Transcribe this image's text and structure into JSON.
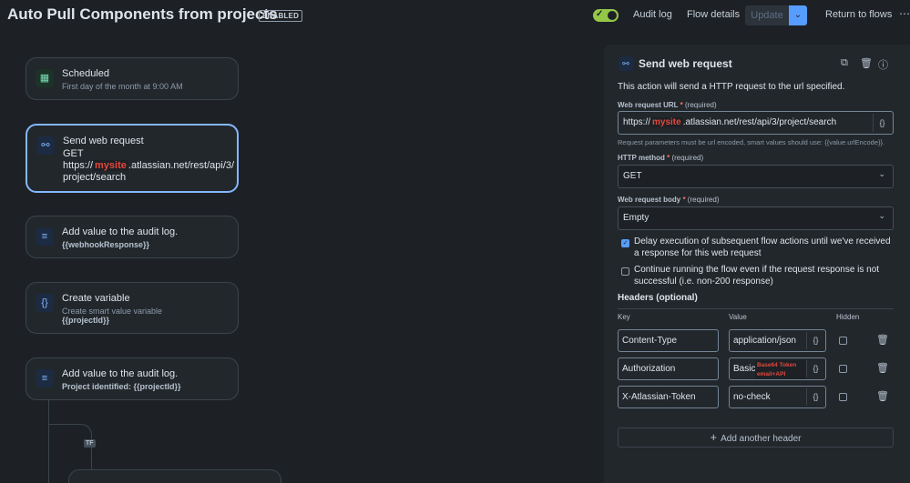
{
  "header": {
    "title": "Auto Pull Components from projects",
    "status_badge": "ENABLED",
    "audit_log": "Audit log",
    "flow_details": "Flow details",
    "update": "Update",
    "return": "Return to flows"
  },
  "nodes": [
    {
      "title": "Scheduled",
      "sub": "First day of the month at 9:00 AM",
      "icon": "calendar-icon"
    },
    {
      "title": "Send web request",
      "method": "GET",
      "url_prefix": "https://",
      "redacted": "mysite",
      "url_suffix": ".atlassian.net/rest/api/3/",
      "url_line2": "project/search",
      "icon": "webhook-icon"
    },
    {
      "title": "Add value to the audit log.",
      "sub": "{{webhookResponse}}",
      "icon": "log-icon"
    },
    {
      "title": "Create variable",
      "sub": "Create smart value variable",
      "sub2": "{{projectId}}",
      "icon": "variable-icon"
    },
    {
      "title": "Add value to the audit log.",
      "sub": "Project identified: {{projectId}}",
      "icon": "log-icon"
    }
  ],
  "branch_tag": "TF",
  "panel": {
    "title": "Send web request",
    "description": "This action will send a HTTP request to the url specified.",
    "url_label": "Web request URL",
    "required": "(required)",
    "url_prefix": "https://",
    "url_redacted": "mysite",
    "url_suffix": ".atlassian.net/rest/api/3/project/search",
    "url_hint": "Request parameters must be url encoded, smart values should use: {{value.urlEncode}}.",
    "method_label": "HTTP method",
    "method_value": "GET",
    "body_label": "Web request body",
    "body_value": "Empty",
    "delay_text": "Delay execution of subsequent flow actions until we've received a response for this web request",
    "delay_checked": true,
    "continue_text": "Continue running the flow even if the request response is not successful (i.e. non-200 response)",
    "continue_checked": false,
    "headers_title": "Headers (optional)",
    "col_key": "Key",
    "col_value": "Value",
    "col_hidden": "Hidden",
    "headers": [
      {
        "key": "Content-Type",
        "value": "application/json"
      },
      {
        "key": "Authorization",
        "value": "Basic",
        "redacted": "Base64 Token email+API"
      },
      {
        "key": "X-Atlassian-Token",
        "value": "no-check"
      }
    ],
    "add_header": "Add another header"
  },
  "colors": {
    "accent": "#579dff",
    "toggle_on": "#94c748",
    "redaction": "#e2483d"
  }
}
